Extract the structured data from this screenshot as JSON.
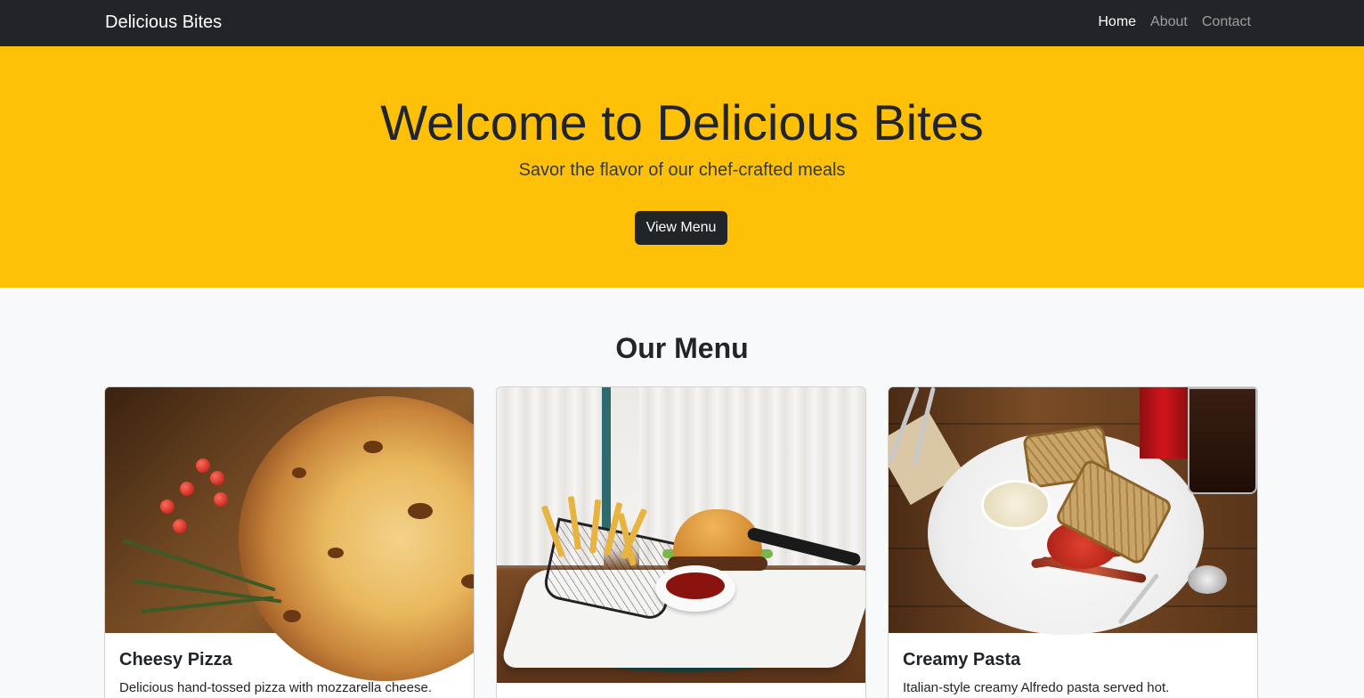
{
  "navbar": {
    "brand": "Delicious Bites",
    "links": [
      {
        "label": "Home",
        "active": true
      },
      {
        "label": "About",
        "active": false
      },
      {
        "label": "Contact",
        "active": false
      }
    ]
  },
  "hero": {
    "title": "Welcome to Delicious Bites",
    "subtitle": "Savor the flavor of our chef-crafted meals",
    "button_label": "View Menu"
  },
  "menu": {
    "title": "Our Menu",
    "items": [
      {
        "title": "Cheesy Pizza",
        "text": "Delicious hand-tossed pizza with mozzarella cheese.",
        "image": "pizza-photo"
      },
      {
        "title": "",
        "text": "",
        "image": "burger-photo"
      },
      {
        "title": "Creamy Pasta",
        "text": "Italian-style creamy Alfredo pasta served hot.",
        "image": "sandwich-photo"
      }
    ]
  },
  "colors": {
    "navbar_bg": "#212529",
    "hero_bg": "#ffc107",
    "page_bg": "#f8f9fa",
    "button_bg": "#212529"
  }
}
